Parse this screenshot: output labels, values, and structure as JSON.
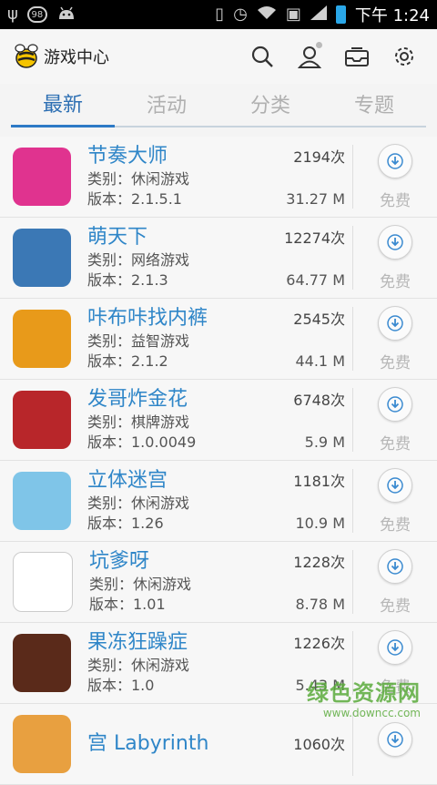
{
  "statusbar": {
    "time": "下午 1:24",
    "badge": "98"
  },
  "header": {
    "title": "游戏中心"
  },
  "tabs": [
    {
      "label": "最新",
      "active": true
    },
    {
      "label": "活动",
      "active": false
    },
    {
      "label": "分类",
      "active": false
    },
    {
      "label": "专题",
      "active": false
    }
  ],
  "apps": [
    {
      "name": "节奏大师",
      "downloads": "2194次",
      "category": "类别：休闲游戏",
      "version": "版本：2.1.5.1",
      "size": "31.27 M",
      "price": "免费",
      "icon_color": "#e0338f"
    },
    {
      "name": "萌天下",
      "downloads": "12274次",
      "category": "类别：网络游戏",
      "version": "版本：2.1.3",
      "size": "64.77 M",
      "price": "免费",
      "icon_color": "#3b78b5"
    },
    {
      "name": "咔布咔找内裤",
      "downloads": "2545次",
      "category": "类别：益智游戏",
      "version": "版本：2.1.2",
      "size": "44.1 M",
      "price": "免费",
      "icon_color": "#e89a1a"
    },
    {
      "name": "发哥炸金花",
      "downloads": "6748次",
      "category": "类别：棋牌游戏",
      "version": "版本：1.0.0049",
      "size": "5.9 M",
      "price": "免费",
      "icon_color": "#b8262a"
    },
    {
      "name": "立体迷宫",
      "downloads": "1181次",
      "category": "类别：休闲游戏",
      "version": "版本：1.26",
      "size": "10.9 M",
      "price": "免费",
      "icon_color": "#7fc5e8"
    },
    {
      "name": "坑爹呀",
      "downloads": "1228次",
      "category": "类别：休闲游戏",
      "version": "版本：1.01",
      "size": "8.78 M",
      "price": "免费",
      "icon_color": "#ffffff"
    },
    {
      "name": "果冻狂躁症",
      "downloads": "1226次",
      "category": "类别：休闲游戏",
      "version": "版本：1.0",
      "size": "5.43 M",
      "price": "免费",
      "icon_color": "#5a2a1a"
    },
    {
      "name": "宫 Labyrinth",
      "downloads": "1060次",
      "category": "",
      "version": "",
      "size": "",
      "price": "",
      "icon_color": "#e8a040"
    }
  ],
  "watermark": {
    "main": "绿色资源网",
    "sub": "www.downcc.com"
  }
}
